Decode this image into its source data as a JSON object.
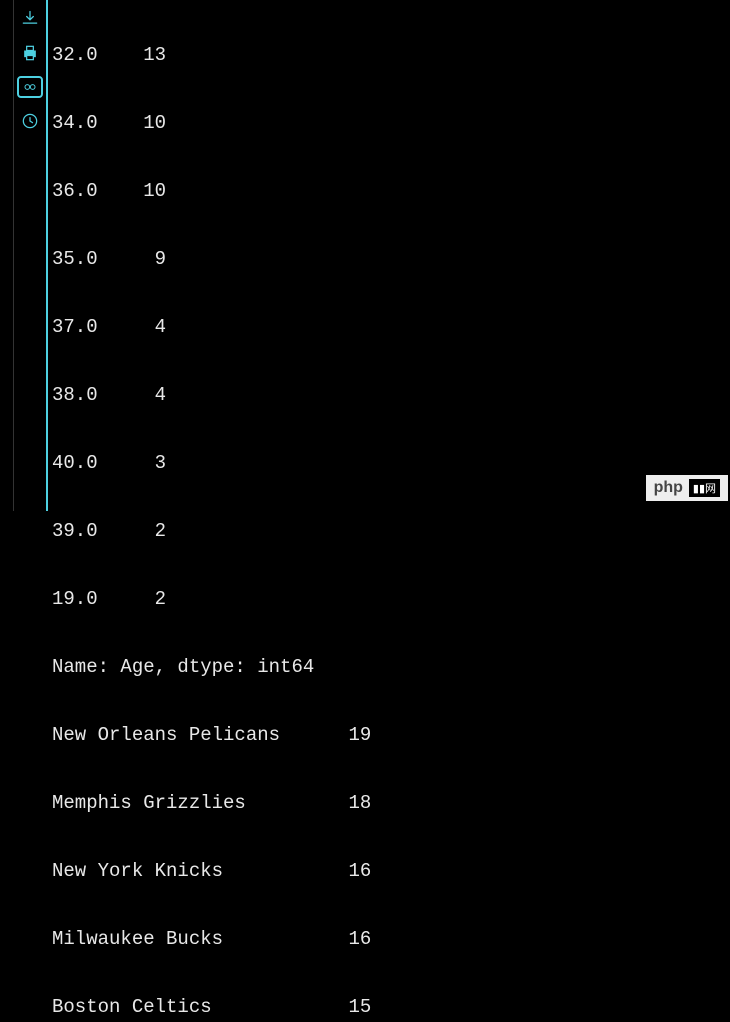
{
  "age_counts": [
    {
      "key": "32.0",
      "val": "13"
    },
    {
      "key": "34.0",
      "val": "10"
    },
    {
      "key": "36.0",
      "val": "10"
    },
    {
      "key": "35.0",
      "val": "9"
    },
    {
      "key": "37.0",
      "val": "4"
    },
    {
      "key": "38.0",
      "val": "4"
    },
    {
      "key": "40.0",
      "val": "3"
    },
    {
      "key": "39.0",
      "val": "2"
    },
    {
      "key": "19.0",
      "val": "2"
    }
  ],
  "series_info": "Name: Age, dtype: int64",
  "team_counts": [
    {
      "key": "New Orleans Pelicans",
      "val": "19"
    },
    {
      "key": "Memphis Grizzlies",
      "val": "18"
    },
    {
      "key": "New York Knicks",
      "val": "16"
    },
    {
      "key": "Milwaukee Bucks",
      "val": "16"
    },
    {
      "key": "Boston Celtics",
      "val": "15"
    }
  ],
  "watermark": {
    "brand": "php",
    "suffix": "▮▮网"
  }
}
